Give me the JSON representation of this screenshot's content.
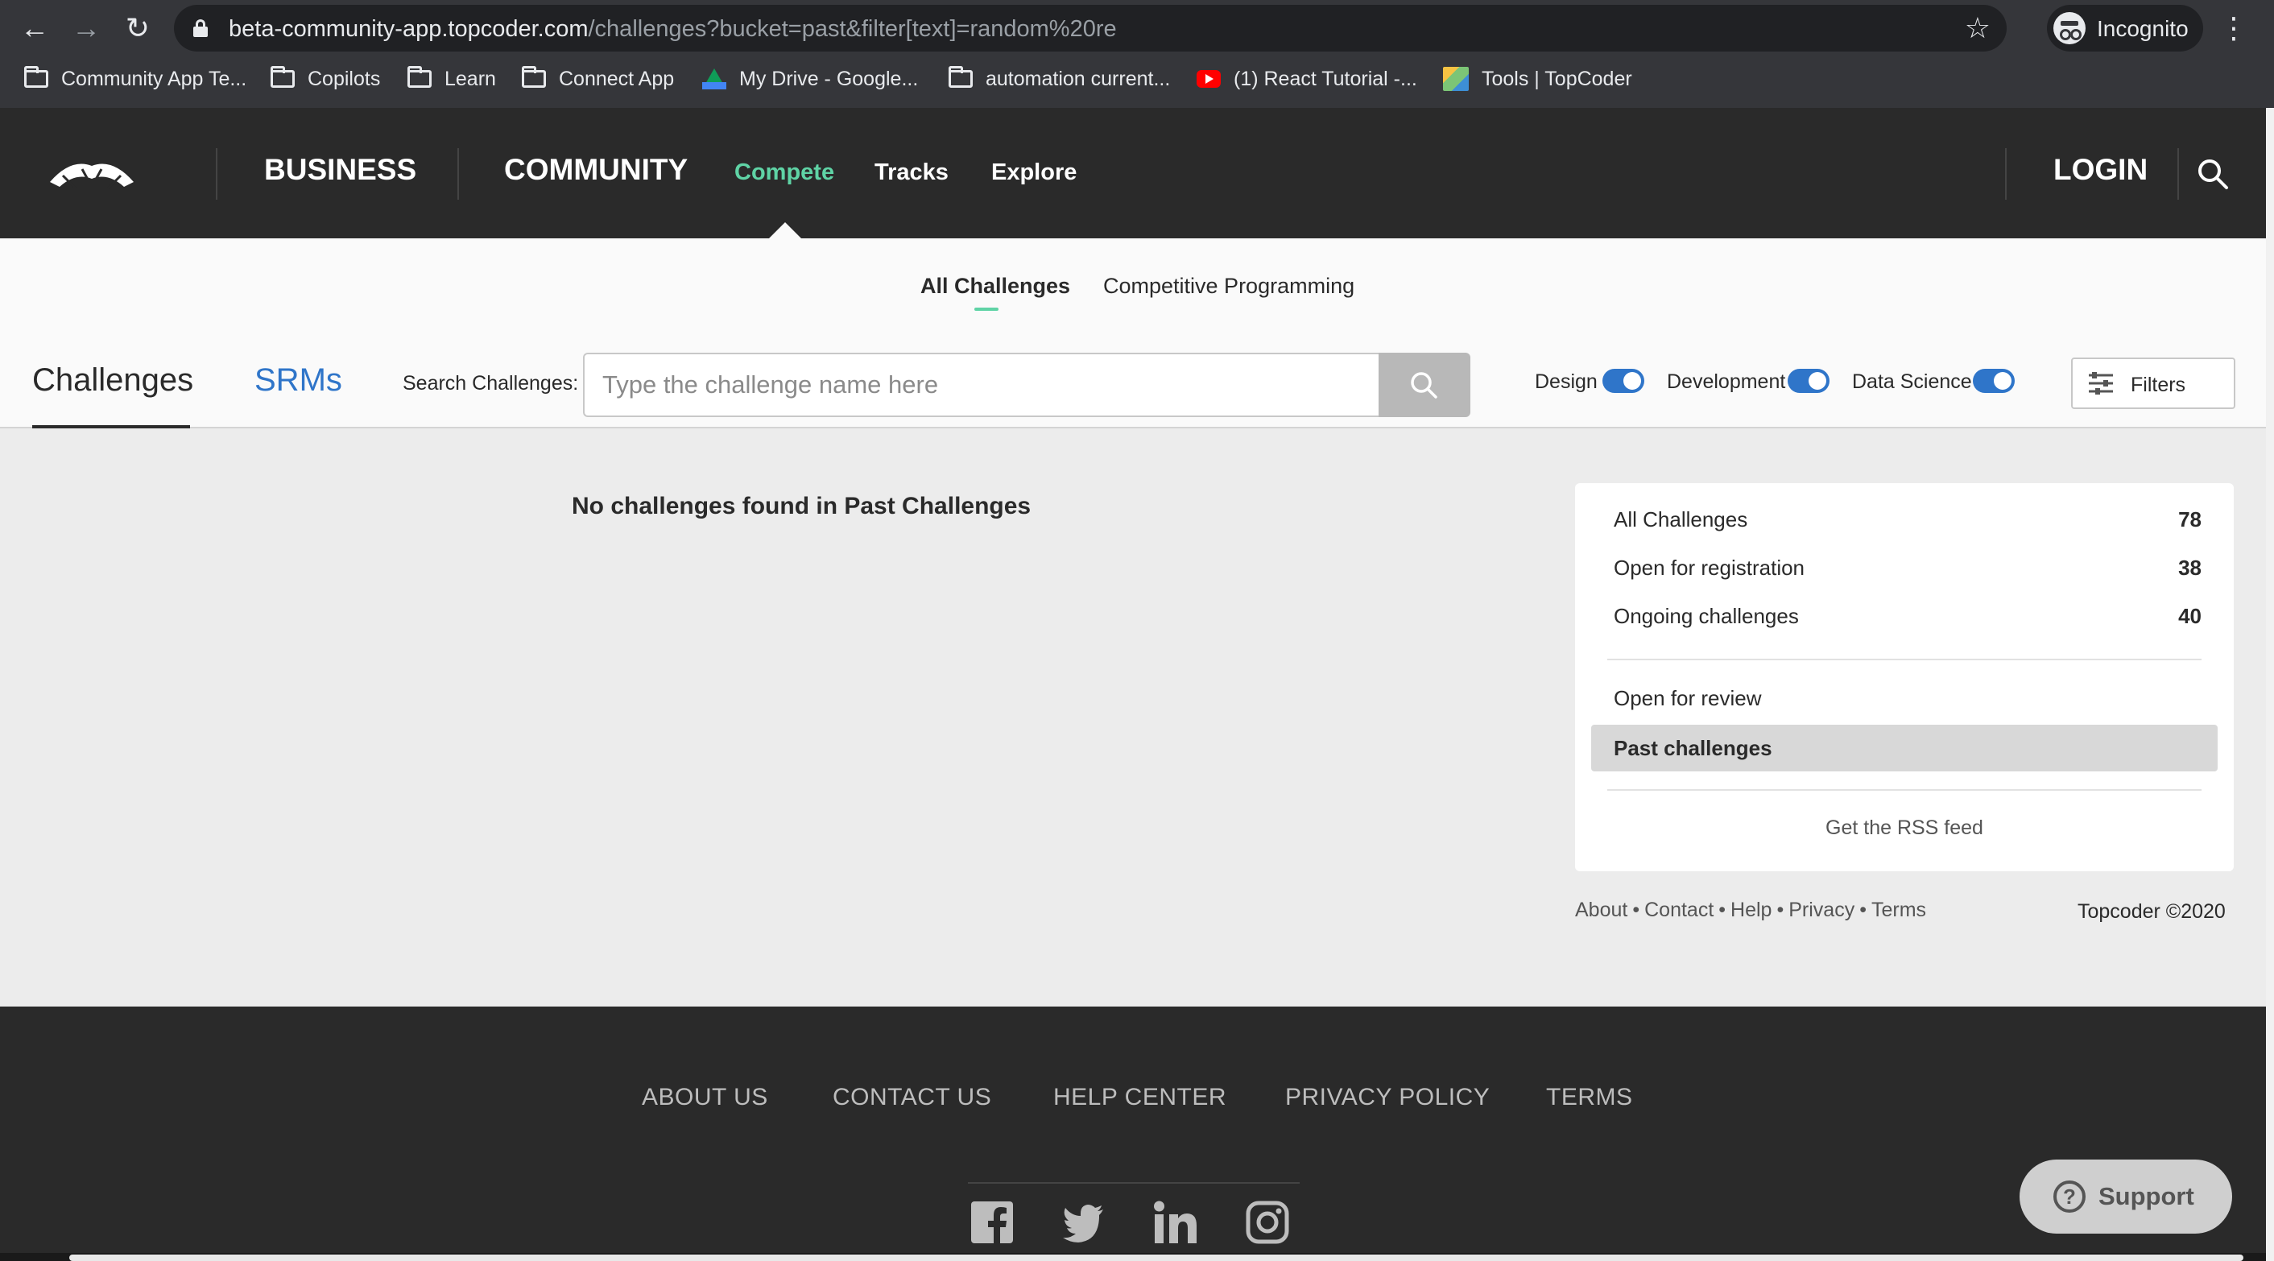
{
  "browser": {
    "url_host": "beta-community-app.topcoder.com",
    "url_path": "/challenges?bucket=past&filter[text]=random%20re",
    "profile_label": "Incognito",
    "bookmarks": [
      {
        "label": "Community App Te...",
        "icon": "folder-icon"
      },
      {
        "label": "Copilots",
        "icon": "folder-icon"
      },
      {
        "label": "Learn",
        "icon": "folder-icon"
      },
      {
        "label": "Connect App",
        "icon": "folder-icon"
      },
      {
        "label": "My Drive - Google...",
        "icon": "google-drive-icon"
      },
      {
        "label": "automation current...",
        "icon": "folder-icon"
      },
      {
        "label": "(1) React Tutorial -...",
        "icon": "youtube-icon"
      },
      {
        "label": "Tools | TopCoder",
        "icon": "topcoder-favicon-icon"
      }
    ]
  },
  "header": {
    "nav": {
      "business": "BUSINESS",
      "community": "COMMUNITY",
      "compete": "Compete",
      "tracks": "Tracks",
      "explore": "Explore"
    },
    "login": "LOGIN",
    "accent_color": "#5fd3a5"
  },
  "subnav": {
    "tabs": [
      "All Challenges",
      "Competitive Programming"
    ],
    "active_tab": "All Challenges"
  },
  "toolbar": {
    "challenges_tab": "Challenges",
    "srms_tab": "SRMs",
    "search_label": "Search Challenges:",
    "search_placeholder": "Type the challenge name here",
    "search_value": "",
    "tracks": [
      {
        "label": "Design",
        "enabled": true
      },
      {
        "label": "Development",
        "enabled": true
      },
      {
        "label": "Data Science",
        "enabled": true
      }
    ],
    "filters_label": "Filters",
    "toggle_color": "#2f75c9"
  },
  "main": {
    "empty_message": "No challenges found in Past Challenges"
  },
  "sidebar": {
    "buckets": [
      {
        "label": "All Challenges",
        "count": "78"
      },
      {
        "label": "Open for registration",
        "count": "38"
      },
      {
        "label": "Ongoing challenges",
        "count": "40"
      },
      {
        "label": "Open for review",
        "count": ""
      },
      {
        "label": "Past challenges",
        "count": "",
        "selected": true
      }
    ],
    "rss": "Get the RSS feed",
    "links": [
      "About",
      "Contact",
      "Help",
      "Privacy",
      "Terms"
    ],
    "copyright": "Topcoder ©2020"
  },
  "footer": {
    "links": [
      "ABOUT US",
      "CONTACT US",
      "HELP CENTER",
      "PRIVACY POLICY",
      "TERMS"
    ],
    "social": [
      "facebook-icon",
      "twitter-icon",
      "linkedin-icon",
      "instagram-icon"
    ],
    "support": "Support"
  }
}
